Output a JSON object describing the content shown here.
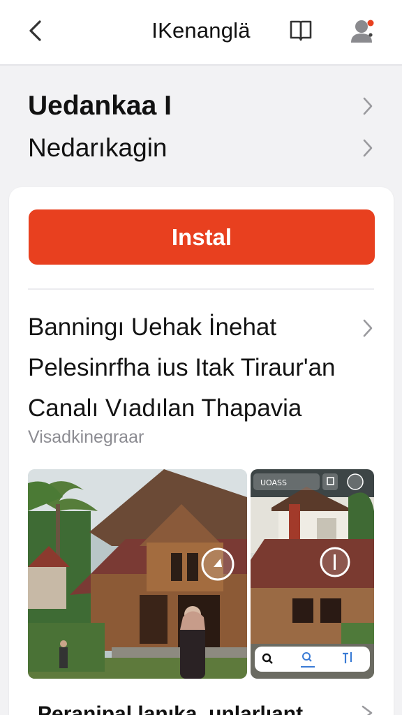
{
  "header": {
    "title": "IKenanglä"
  },
  "menu": {
    "primary_label": "Uedankaa I",
    "secondary_label": "Nedarıkagin"
  },
  "install_label": "Instal",
  "description": {
    "line1": "Banningı Uehak İnehat",
    "line2": "Pelesinrfha ius Itak Tiraur'an",
    "line3": "Canalı Vıadılan Thapavia"
  },
  "category": "Visadkinegraar",
  "screenshot_overlay": {
    "label": "UOASS"
  },
  "bottom_title": "Peranipal lanıka, unlarlıant",
  "colors": {
    "accent": "#e8401f",
    "user_dot": "#e8401f"
  },
  "icons": {
    "back": "chevron-left-icon",
    "book": "book-icon",
    "user": "user-icon",
    "chevron": "chevron-right-icon",
    "search": "search-icon"
  }
}
